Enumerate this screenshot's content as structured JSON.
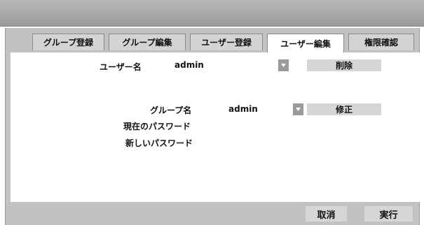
{
  "tabs": [
    {
      "label": "グループ登録"
    },
    {
      "label": "グループ編集"
    },
    {
      "label": "ユーザー登録"
    },
    {
      "label": "ユーザー編集",
      "active": true
    },
    {
      "label": "権限確認"
    }
  ],
  "user_row": {
    "label": "ユーザー名",
    "selected": "admin",
    "delete_label": "削除"
  },
  "group_row": {
    "label": "グループ名",
    "selected": "admin",
    "modify_label": "修正"
  },
  "current_password": {
    "label": "現在のパスワード",
    "value": ""
  },
  "new_password": {
    "label": "新しいパスワード",
    "value": ""
  },
  "footer": {
    "cancel_label": "取消",
    "execute_label": "実行"
  },
  "colors": {
    "panel_gray": "#c2c2c2",
    "dropdown_arrow_bg": "#9a9a9a",
    "button_bg": "#d6d6d6"
  },
  "icons": {
    "dropdown_arrow": "chevron-down-icon"
  }
}
